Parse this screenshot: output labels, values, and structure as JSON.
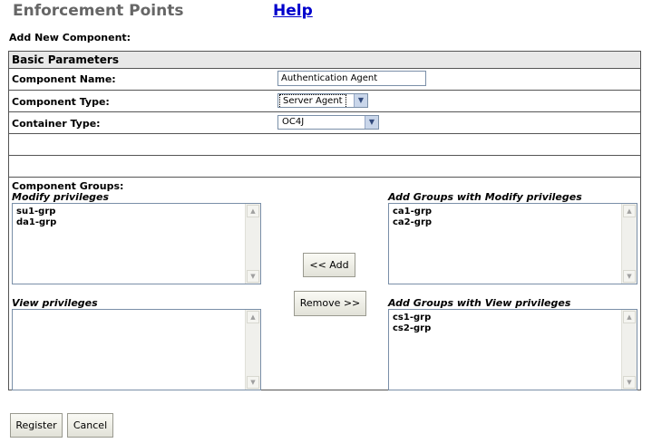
{
  "header": {
    "title": "Enforcement Points",
    "help_link": "Help"
  },
  "subheading": "Add New Component:",
  "section": {
    "title": "Basic Parameters"
  },
  "fields": {
    "component_name": {
      "label": "Component Name:",
      "value": "Authentication Agent"
    },
    "component_type": {
      "label": "Component Type:",
      "value": "Server Agent"
    },
    "container_type": {
      "label": "Container Type:",
      "value": "OC4J"
    }
  },
  "groups": {
    "label": "Component Groups:",
    "modify_privileges": {
      "label": "Modify privileges",
      "items": [
        "su1-grp",
        "da1-grp"
      ]
    },
    "add_modify": {
      "label": "Add Groups with Modify privileges",
      "items": [
        "ca1-grp",
        "ca2-grp"
      ]
    },
    "view_privileges": {
      "label": "View privileges",
      "items": []
    },
    "add_view": {
      "label": "Add Groups with View privileges",
      "items": [
        "cs1-grp",
        "cs2-grp"
      ]
    },
    "add_button": "<<  Add",
    "remove_button": "Remove >>"
  },
  "footer": {
    "register_button": "Register",
    "cancel_button": "Cancel"
  }
}
